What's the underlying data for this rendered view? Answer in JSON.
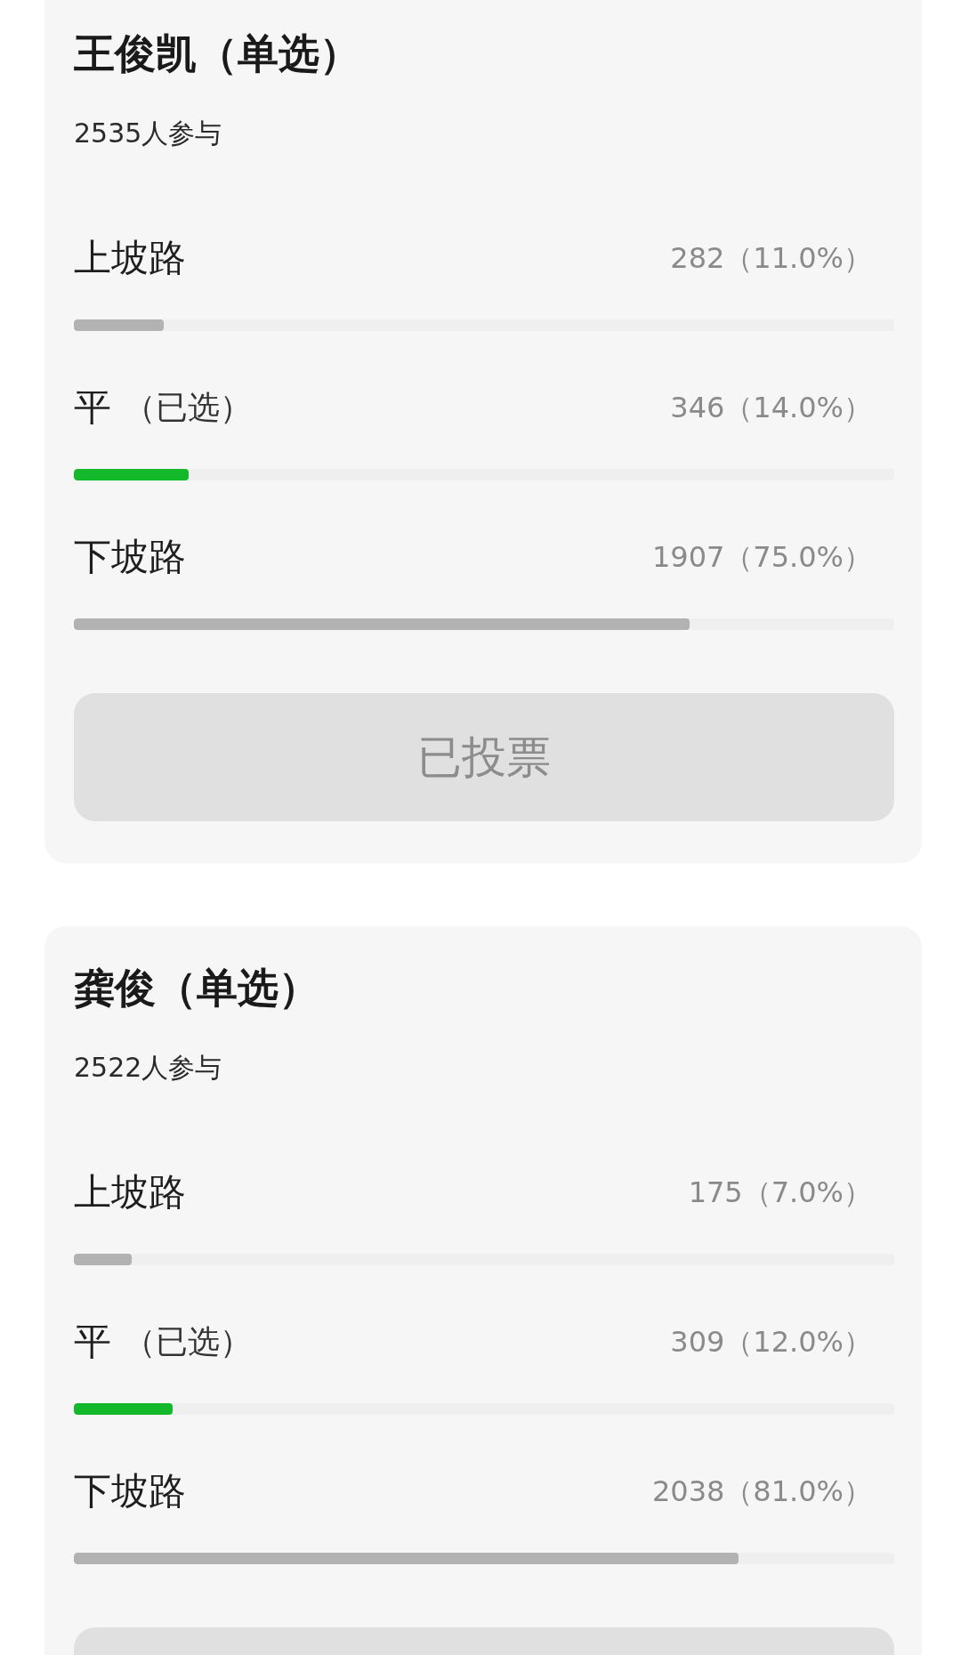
{
  "polls": [
    {
      "title": "王俊凯（单选）",
      "participants": "2535人参与",
      "options": [
        {
          "label": "上坡路",
          "selected": false,
          "result": "282（11.0%）",
          "level": 0.11
        },
        {
          "label": "平",
          "note": "（已选）",
          "selected": true,
          "result": "346（14.0%）",
          "level": 0.14
        },
        {
          "label": "下坡路",
          "selected": false,
          "result": "1907（75.0%）",
          "level": 0.75
        }
      ],
      "vote_button": {
        "label": "已投票",
        "disabled": true
      }
    },
    {
      "title": "龚俊（单选）",
      "participants": "2522人参与",
      "options": [
        {
          "label": "上坡路",
          "selected": false,
          "result": "175（7.0%）",
          "level": 0.07
        },
        {
          "label": "平",
          "note": "（已选）",
          "selected": true,
          "result": "309（12.0%）",
          "level": 0.12
        },
        {
          "label": "下坡路",
          "selected": false,
          "result": "2038（81.0%）",
          "level": 0.81
        }
      ],
      "vote_button": {
        "disabled": true
      }
    }
  ]
}
